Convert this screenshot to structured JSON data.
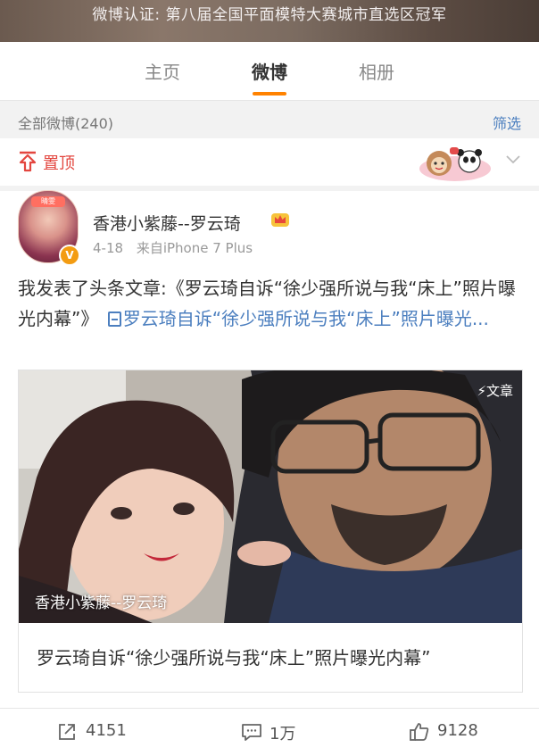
{
  "header": {
    "verify_text": "微博认证: 第八届全国平面模特大赛城市直选区冠军"
  },
  "tabs": [
    {
      "label": "主页",
      "active": false
    },
    {
      "label": "微博",
      "active": true
    },
    {
      "label": "相册",
      "active": false
    }
  ],
  "accent_color": "#ff8200",
  "filter": {
    "count_label": "全部微博(240)",
    "filter_label": "筛选"
  },
  "pinned": {
    "label": "置顶",
    "icon": "pin-top-icon"
  },
  "post": {
    "avatar_sign": "晴雯",
    "username": "香港小紫藤--罗云琦",
    "time": "4-18",
    "source": "来自iPhone 7 Plus",
    "text": "我发表了头条文章:《罗云琦自诉“徐少强所说与我“床上”照片曝光内幕”》",
    "link_text": "罗云琦自诉“徐少强所说与我“床上”照片曝光...",
    "card": {
      "badge": "⚡文章",
      "author_overlay": "香港小紫藤--罗云琦",
      "title": "罗云琦自诉“徐少强所说与我“床上”照片曝光内幕”"
    },
    "actions": {
      "repost_count": "4151",
      "comment_count": "1万",
      "like_count": "9128"
    }
  }
}
